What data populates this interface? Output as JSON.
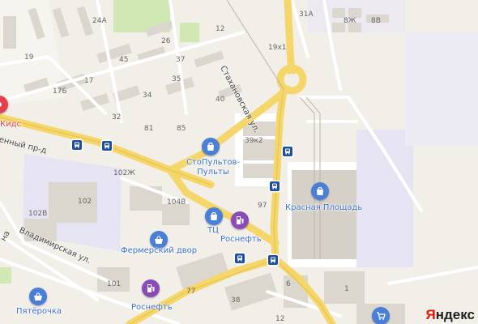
{
  "map": {
    "buildings": [
      "24A",
      "26",
      "19",
      "45",
      "37",
      "12",
      "19х1",
      "31А",
      "8Ж",
      "8В",
      "17",
      "17Б",
      "35",
      "34",
      "32",
      "40",
      "81",
      "85",
      "39к2",
      "102Ж",
      "102",
      "104В",
      "102В",
      "97",
      "101",
      "77",
      "38",
      "12",
      "1",
      "6"
    ],
    "streets": [
      "Стахановская ул.",
      "енный пр-д",
      "Владимирская ул.",
      "на"
    ],
    "pois": [
      {
        "name": "СтоПультов-Пульты",
        "icon": "shopping-bag-icon",
        "color": "#4a7fd8"
      },
      {
        "name": "Красная Площадь",
        "icon": "shopping-bag-icon",
        "color": "#4a7fd8"
      },
      {
        "name": "ТЦ",
        "icon": "shopping-bag-icon",
        "color": "#4a7fd8"
      },
      {
        "name": "Роснефть",
        "icon": "fuel-pump-icon",
        "color": "#8a4bb8"
      },
      {
        "name": "Фермерский двор",
        "icon": "basket-icon",
        "color": "#4a7fd8"
      },
      {
        "name": "Роснефть",
        "icon": "fuel-pump-icon",
        "color": "#8a4bb8"
      },
      {
        "name": "Пятёрочка",
        "icon": "basket-icon",
        "color": "#4a7fd8"
      },
      {
        "name": "Кидс",
        "icon": "pin-icon",
        "color": "#e4404b"
      }
    ],
    "bus_stop_icon": "bus-stop-icon",
    "logo": {
      "first": "Я",
      "rest": "ндекс"
    }
  }
}
